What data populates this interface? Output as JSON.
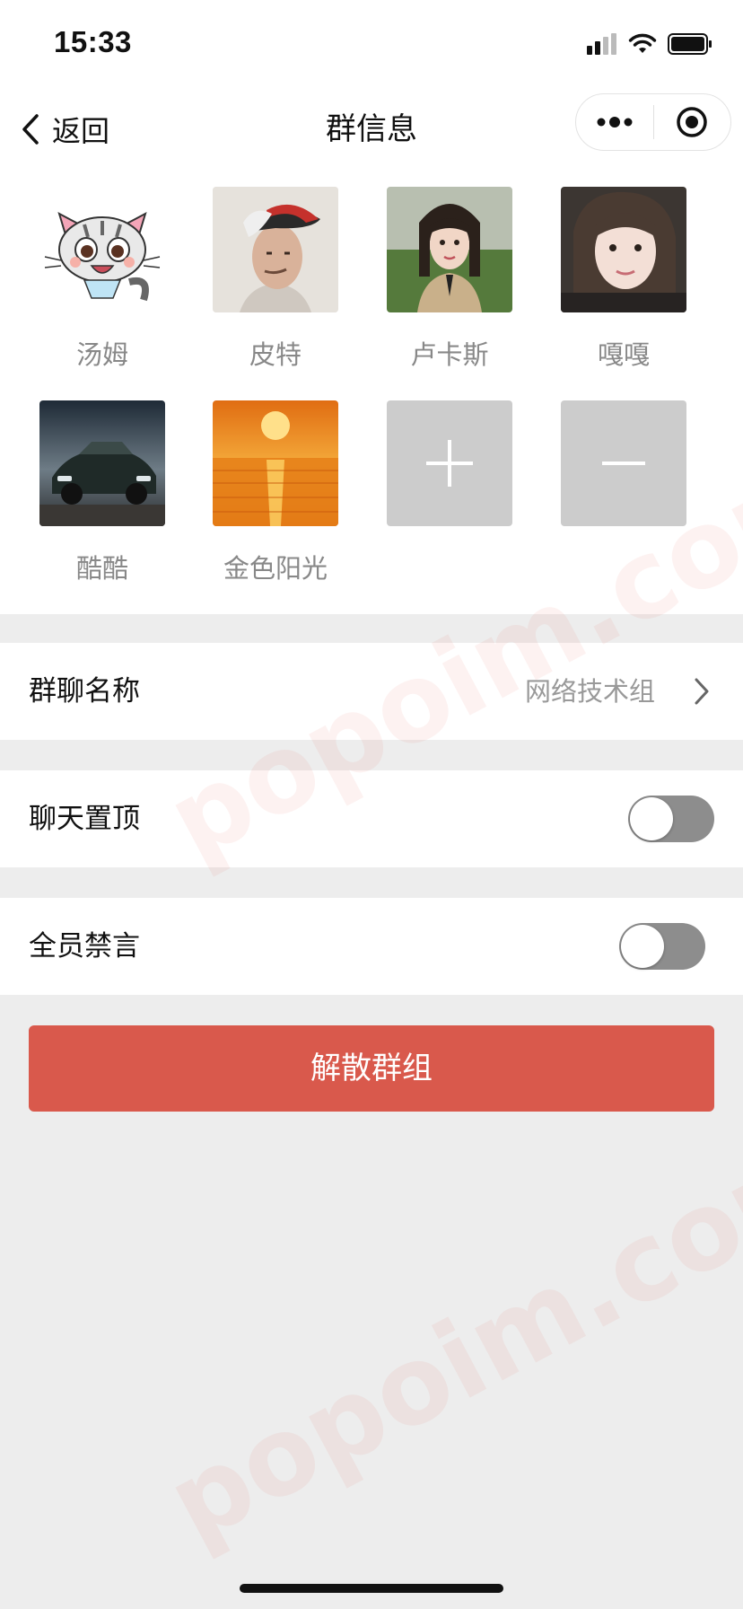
{
  "status_bar": {
    "time": "15:33"
  },
  "nav": {
    "back_label": "返回",
    "title": "群信息"
  },
  "members": [
    {
      "name": "汤姆",
      "avatar": "cartoon-cat"
    },
    {
      "name": "皮特",
      "avatar": "man-red-cap"
    },
    {
      "name": "卢卡斯",
      "avatar": "girl-outdoor"
    },
    {
      "name": "嘎嘎",
      "avatar": "girl-portrait"
    },
    {
      "name": "酷酷",
      "avatar": "sports-car"
    },
    {
      "name": "金色阳光",
      "avatar": "golden-sunset"
    }
  ],
  "actions": {
    "add_icon": "plus-icon",
    "remove_icon": "minus-icon"
  },
  "settings": {
    "group_name_label": "群聊名称",
    "group_name_value": "网络技术组",
    "pin_chat_label": "聊天置顶",
    "pin_chat_enabled": false,
    "mute_all_label": "全员禁言",
    "mute_all_enabled": false
  },
  "dissolve_button": "解散群组",
  "watermark": "popoim.com",
  "colors": {
    "danger": "#d9594c",
    "toggle_off": "#8d8d8d",
    "background": "#ededed"
  }
}
